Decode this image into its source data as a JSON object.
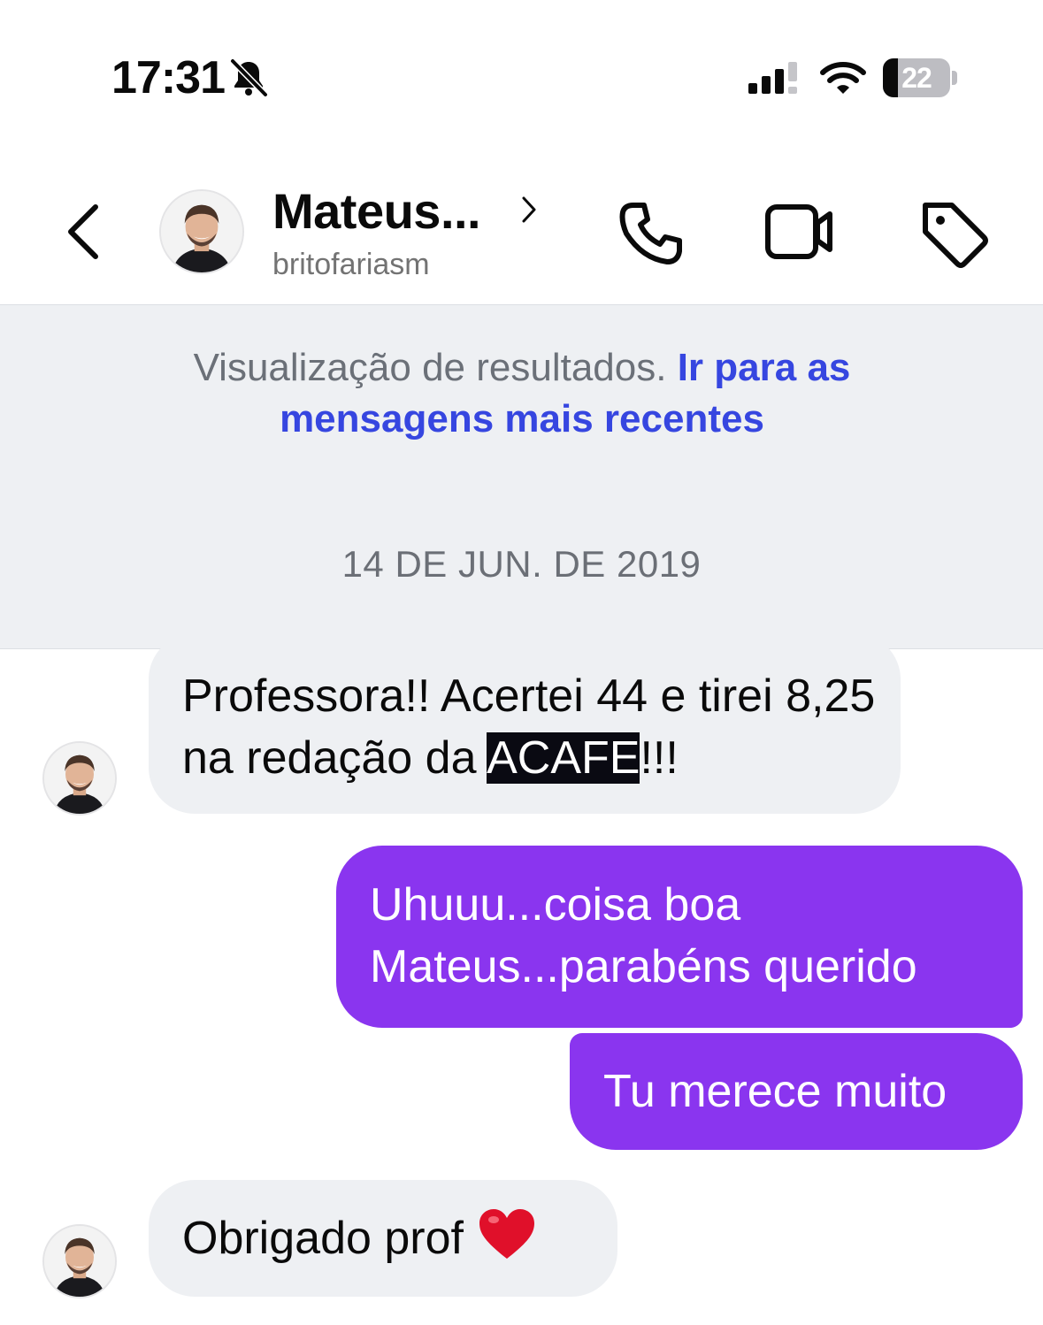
{
  "status_bar": {
    "time": "17:31",
    "battery_level": "22",
    "battery_fraction": 0.22
  },
  "header": {
    "contact_name": "Mateus...",
    "username": "britofariasm",
    "icons": [
      "back-icon",
      "phone-icon",
      "video-icon",
      "tag-icon"
    ]
  },
  "banner": {
    "text": "Visualização de resultados.",
    "link": "Ir para as mensagens mais recentes"
  },
  "conversation": {
    "date": "14 DE JUN. DE 2019",
    "messages": [
      {
        "direction": "incoming",
        "text_before": "Professora!! Acertei 44 e tirei 8,25 na redação da ",
        "highlight": "ACAFE",
        "text_after": "!!!"
      },
      {
        "direction": "outgoing",
        "line1": "Uhuuu...coisa boa",
        "line2": "Mateus...parabéns querido"
      },
      {
        "direction": "outgoing",
        "text": "Tu merece muito"
      },
      {
        "direction": "incoming",
        "text": "Obrigado prof",
        "emoji": "heart-icon"
      }
    ]
  },
  "colors": {
    "outgoing_bubble": "#8a35ef",
    "incoming_bubble": "#eef0f3",
    "link": "#3646e0",
    "highlight": "#0a0a12"
  }
}
